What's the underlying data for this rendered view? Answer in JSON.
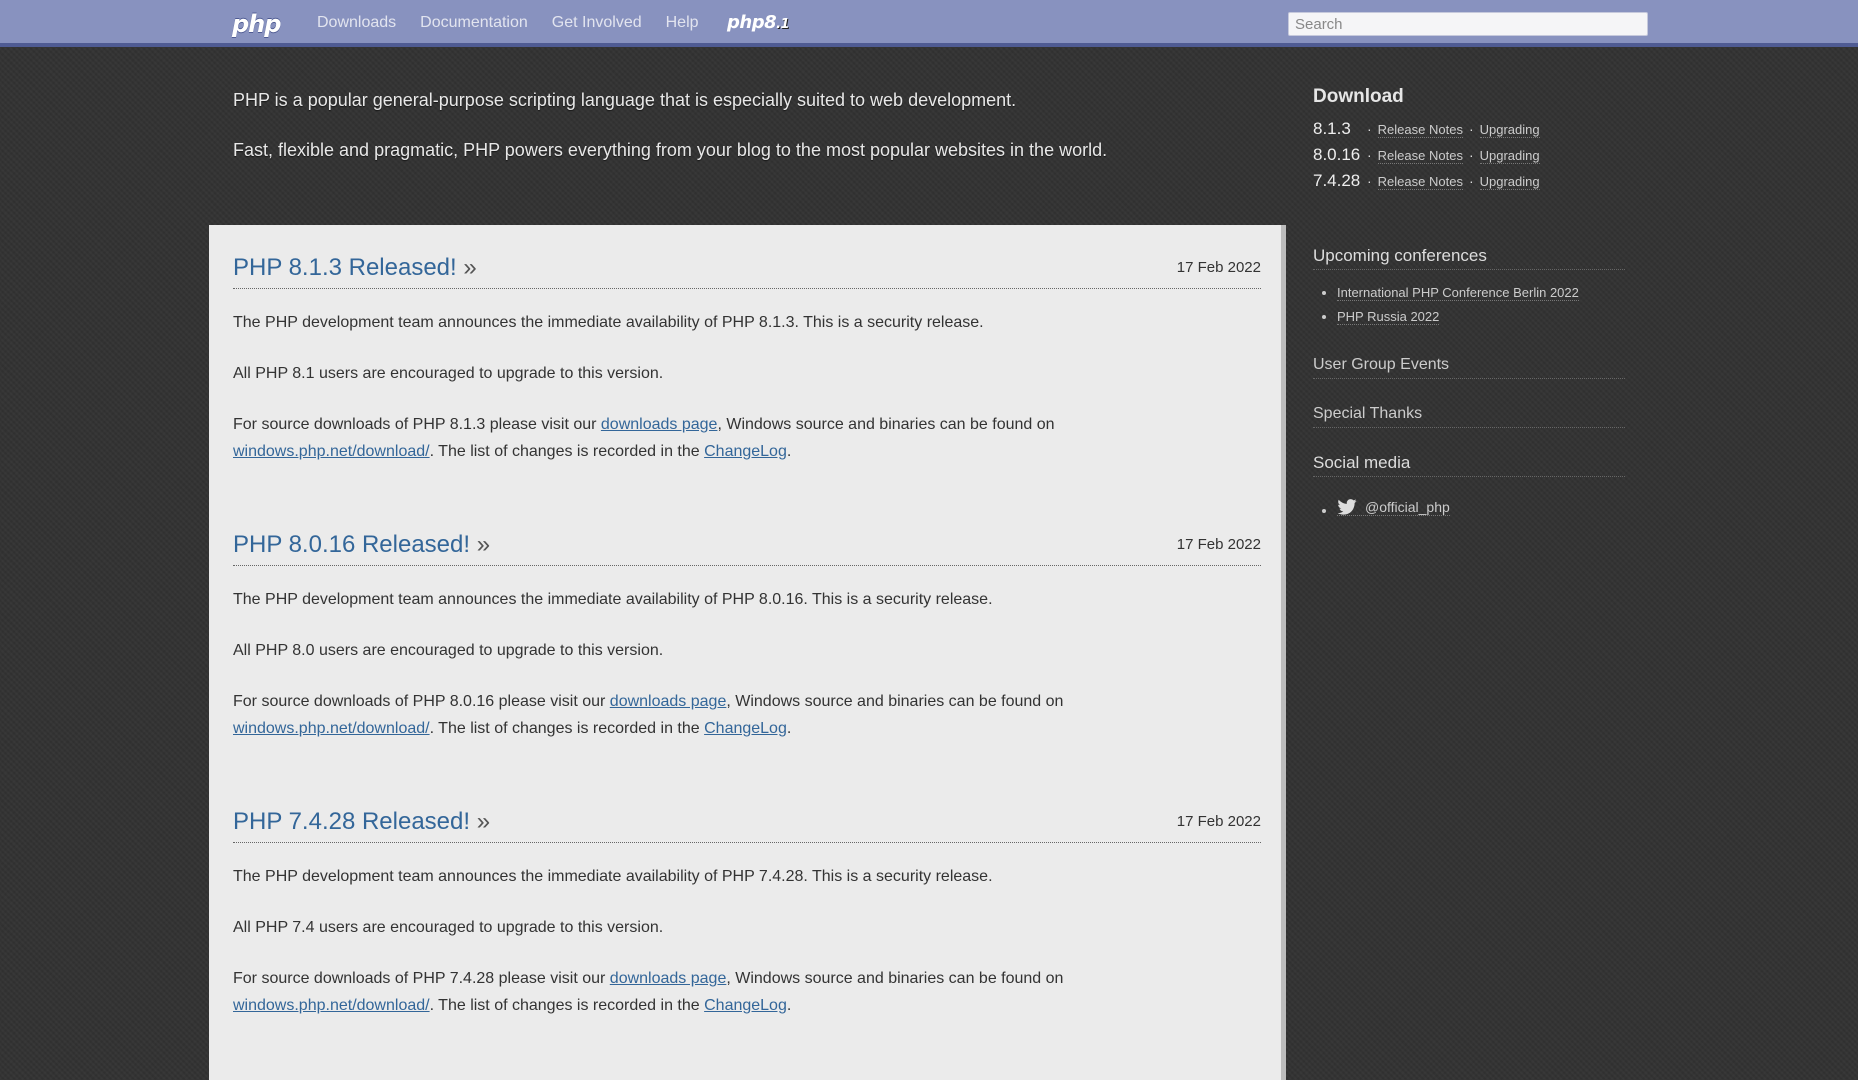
{
  "nav": {
    "logo": "php",
    "links": [
      "Downloads",
      "Documentation",
      "Get Involved",
      "Help"
    ],
    "version_badge_main": "php8",
    "version_badge_minor": ".1",
    "search_placeholder": "Search"
  },
  "intro": {
    "line1": "PHP is a popular general-purpose scripting language that is especially suited to web development.",
    "line2": "Fast, flexible and pragmatic, PHP powers everything from your blog to the most popular websites in the world."
  },
  "articles": [
    {
      "title": "PHP 8.1.3 Released!",
      "raquo": "»",
      "date": "17 Feb 2022",
      "p1": "The PHP development team announces the immediate availability of PHP 8.1.3. This is a security release.",
      "p2": "All PHP 8.1 users are encouraged to upgrade to this version.",
      "p3_start": "For source downloads of PHP 8.1.3 please visit our ",
      "p3_link1": "downloads page",
      "p3_mid": ", Windows source and binaries can be found on",
      "p3_link2": "windows.php.net/download/",
      "p3_mid2": ". The list of changes is recorded in the ",
      "p3_link3": "ChangeLog",
      "p3_end": "."
    },
    {
      "title": "PHP 8.0.16 Released!",
      "raquo": "»",
      "date": "17 Feb 2022",
      "p1": "The PHP development team announces the immediate availability of PHP 8.0.16. This is a security release.",
      "p2": "All PHP 8.0 users are encouraged to upgrade to this version.",
      "p3_start": "For source downloads of PHP 8.0.16 please visit our ",
      "p3_link1": "downloads page",
      "p3_mid": ", Windows source and binaries can be found on",
      "p3_link2": "windows.php.net/download/",
      "p3_mid2": ". The list of changes is recorded in the ",
      "p3_link3": "ChangeLog",
      "p3_end": "."
    },
    {
      "title": "PHP 7.4.28 Released!",
      "raquo": "»",
      "date": "17 Feb 2022",
      "p1": "The PHP development team announces the immediate availability of PHP 7.4.28. This is a security release.",
      "p2": "All PHP 7.4 users are encouraged to upgrade to this version.",
      "p3_start": "For source downloads of PHP 7.4.28 please visit our ",
      "p3_link1": "downloads page",
      "p3_mid": ", Windows source and binaries can be found on",
      "p3_link2": "windows.php.net/download/",
      "p3_mid2": ". The list of changes is recorded in the ",
      "p3_link3": "ChangeLog",
      "p3_end": "."
    }
  ],
  "sidebar": {
    "download_title": "Download",
    "downloads": [
      {
        "version": "8.1.3",
        "release_notes": "Release Notes",
        "upgrading": "Upgrading"
      },
      {
        "version": "8.0.16",
        "release_notes": "Release Notes",
        "upgrading": "Upgrading"
      },
      {
        "version": "7.4.28",
        "release_notes": "Release Notes",
        "upgrading": "Upgrading"
      }
    ],
    "separator": "·",
    "conferences_title": "Upcoming conferences",
    "conferences": [
      "International PHP Conference Berlin 2022",
      "PHP Russia 2022"
    ],
    "user_group_events": "User Group Events",
    "special_thanks": "Special Thanks",
    "social_title": "Social media",
    "twitter_handle": "@official_php",
    "icons": {
      "twitter": "twitter-icon"
    }
  }
}
